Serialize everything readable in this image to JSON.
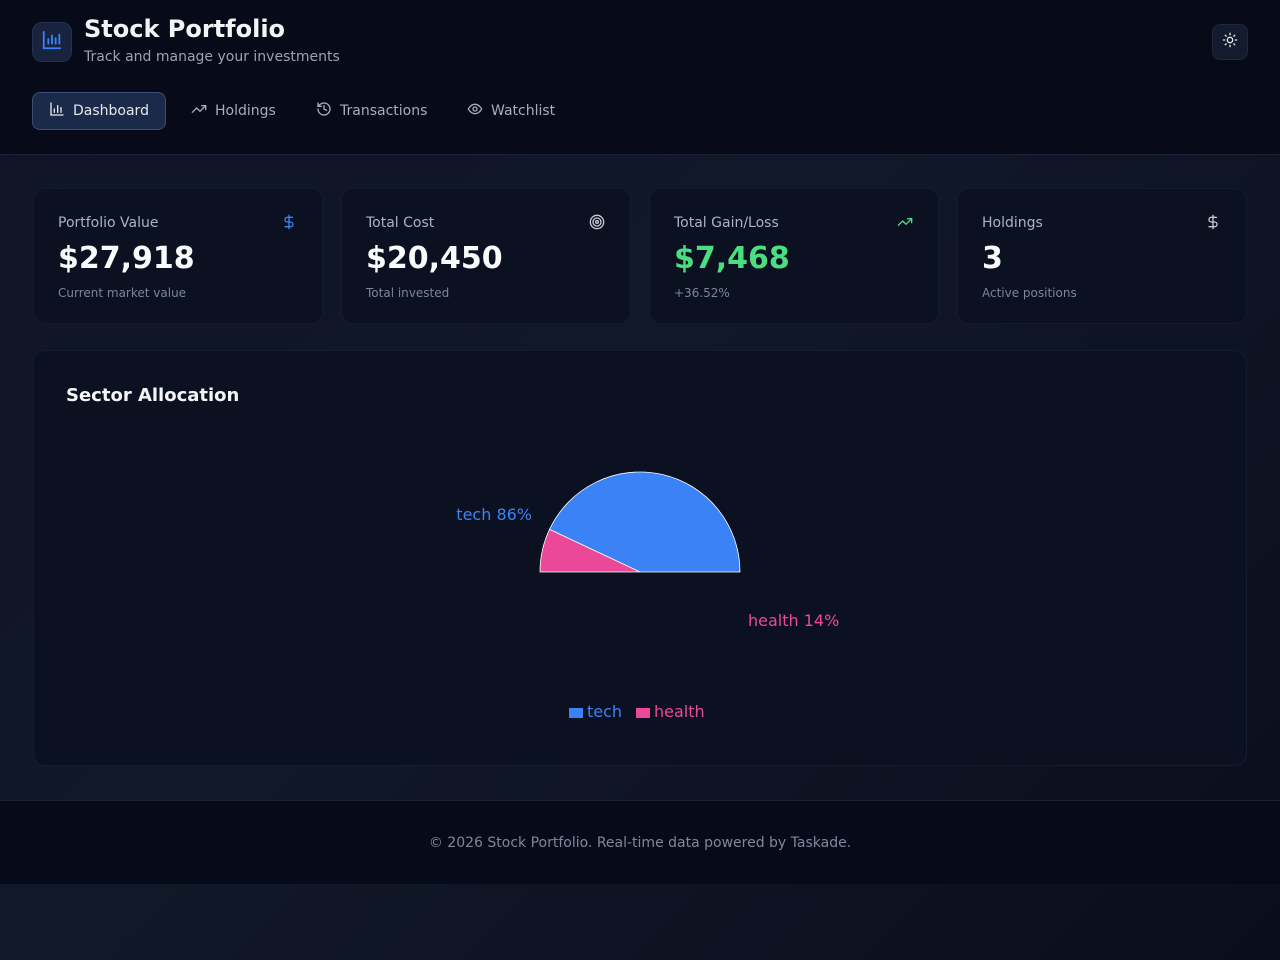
{
  "header": {
    "title": "Stock Portfolio",
    "subtitle": "Track and manage your investments",
    "logo_icon": "bar-chart-icon",
    "theme_toggle_icon": "sun-icon"
  },
  "nav": {
    "tabs": [
      {
        "label": "Dashboard",
        "icon": "bar-chart-icon",
        "active": true
      },
      {
        "label": "Holdings",
        "icon": "trending-up-icon",
        "active": false
      },
      {
        "label": "Transactions",
        "icon": "history-icon",
        "active": false
      },
      {
        "label": "Watchlist",
        "icon": "eye-icon",
        "active": false
      }
    ]
  },
  "stats": [
    {
      "label": "Portfolio Value",
      "value": "$27,918",
      "note": "Current market value",
      "icon": "dollar-icon"
    },
    {
      "label": "Total Cost",
      "value": "$20,450",
      "note": "Total invested",
      "icon": "target-icon"
    },
    {
      "label": "Total Gain/Loss",
      "value": "$7,468",
      "note": "+36.52%",
      "icon": "trending-up-icon"
    },
    {
      "label": "Holdings",
      "value": "3",
      "note": "Active positions",
      "icon": "dollar-icon"
    }
  ],
  "sector_panel": {
    "title": "Sector Allocation"
  },
  "chart_data": {
    "type": "pie",
    "title": "Sector Allocation",
    "slices": [
      {
        "name": "tech",
        "percent": 86,
        "label": "tech 86%",
        "color": "#3b82f6"
      },
      {
        "name": "health",
        "percent": 14,
        "label": "health 14%",
        "color": "#ec4899"
      }
    ],
    "legend": [
      "tech",
      "health"
    ],
    "legend_position": "bottom",
    "layout": "half-pie"
  },
  "footer": {
    "text": "© 2026 Stock Portfolio. Real-time data powered by Taskade."
  },
  "colors": {
    "accent": "#3b82f6",
    "positive": "#4ade80",
    "health": "#ec4899",
    "background": "#0f1426"
  }
}
